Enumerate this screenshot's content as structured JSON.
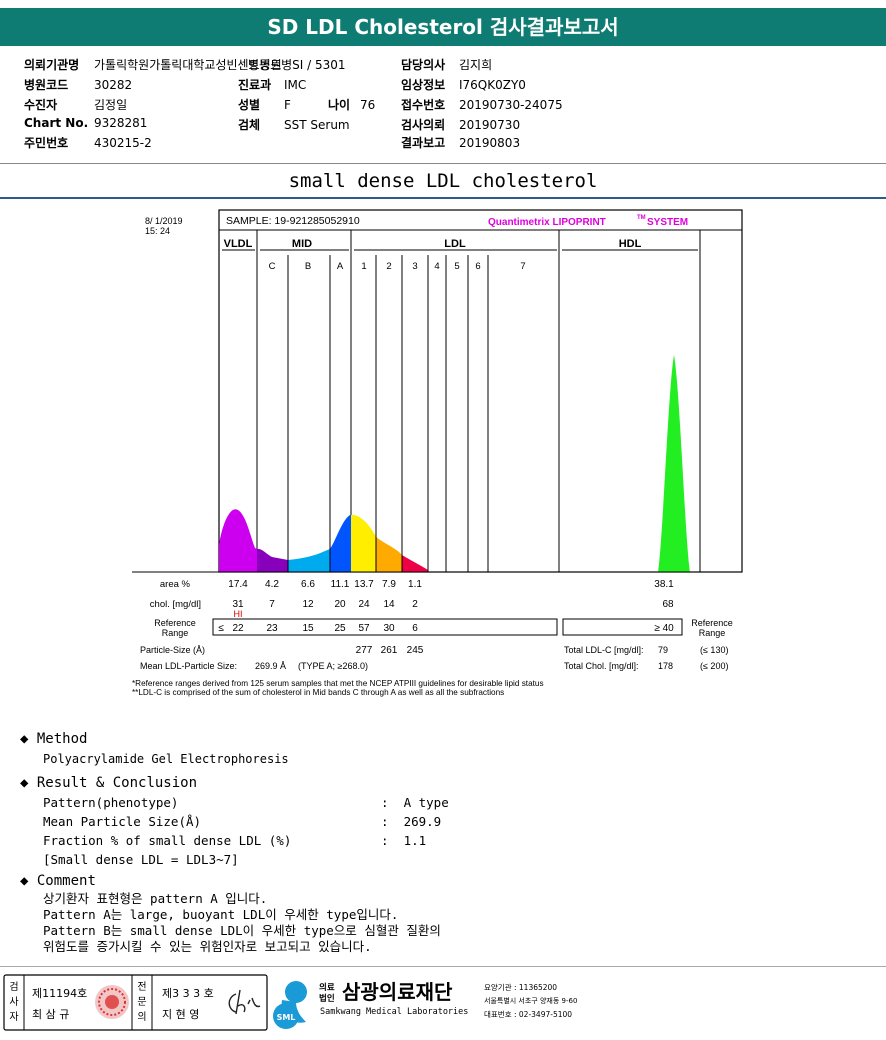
{
  "report_title": "SD LDL Cholesterol 검사결과보고서",
  "info": {
    "left": [
      {
        "label": "의뢰기관명",
        "value": "가톨릭학원가톨릭대학교성빈센트병원"
      },
      {
        "label": "병원코드",
        "value": "30282"
      },
      {
        "label": "수진자",
        "value": "김정일"
      },
      {
        "label": "Chart No.",
        "value": "9328281"
      },
      {
        "label": "주민번호",
        "value": "430215-2"
      }
    ],
    "mid": [
      {
        "label": "",
        "value": "병동트병SI / 5301"
      },
      {
        "label": "진료과",
        "value": "IMC"
      },
      {
        "label": "성별",
        "value": "F"
      },
      {
        "label": "검체",
        "value": "SST Serum"
      }
    ],
    "age": {
      "label": "나이",
      "value": "76"
    },
    "right": [
      {
        "label": "담당의사",
        "value": "김지희"
      },
      {
        "label": "임상정보",
        "value": "I76QK0ZY0"
      },
      {
        "label": "접수번호",
        "value": "20190730-24075"
      },
      {
        "label": "검사의뢰",
        "value": "20190730"
      },
      {
        "label": "결과보고",
        "value": "20190803"
      }
    ]
  },
  "subtitle": "small dense LDL cholesterol",
  "chart": {
    "date": "8/ 1/2019",
    "time": "15: 24",
    "sample": "SAMPLE:  19-921285052910",
    "system": "Quantimetrix LIPOPRINT",
    "system_tm": "TM",
    "system_suffix": "SYSTEM",
    "groups": [
      "VLDL",
      "MID",
      "LDL",
      "HDL"
    ],
    "bands": [
      "C",
      "B",
      "A",
      "1",
      "2",
      "3",
      "4",
      "5",
      "6",
      "7"
    ],
    "area_label": "area %",
    "chol_label": "chol. [mg/dl]",
    "ref_label": "Reference Range",
    "ref_label_right": "Reference Range",
    "area_values": [
      "17.4",
      "4.2",
      "6.6",
      "11.1",
      "13.7",
      "7.9",
      "1.1"
    ],
    "area_hdl": "38.1",
    "chol_values": [
      "31",
      "7",
      "12",
      "20",
      "24",
      "14",
      "2"
    ],
    "chol_hdl": "68",
    "hi_flag": "HI",
    "ref_prefix": "≤",
    "ref_values": [
      "22",
      "23",
      "15",
      "25",
      "57",
      "30",
      "6"
    ],
    "ref_hdl": "≥ 40",
    "particle_label": "Particle-Size (Å)",
    "particle_values": [
      "277",
      "261",
      "245"
    ],
    "mean_label": "Mean LDL-Particle Size:",
    "mean_value": "269.9 Å",
    "mean_type": "(TYPE A; ≥268.0)",
    "total_ldl_label": "Total LDL-C [mg/dl]:",
    "total_ldl_value": "79",
    "total_ldl_ref": "(≤ 130)",
    "total_chol_label": "Total Chol. [mg/dl]:",
    "total_chol_value": "178",
    "total_chol_ref": "(≤ 200)",
    "footnote1": "*Reference ranges derived from 125 serum samples that met the NCEP ATPIII guidelines for desirable lipid status",
    "footnote2": "**LDL-C is comprised of the sum of cholesterol in Mid bands C through A as well as all the subfractions"
  },
  "chart_data": {
    "type": "area",
    "title": "",
    "series": [
      {
        "name": "VLDL",
        "color": "#cc00ee"
      },
      {
        "name": "MID C",
        "color": "#8800cc"
      },
      {
        "name": "MID B",
        "color": "#00aaee"
      },
      {
        "name": "MID A",
        "color": "#0055ff"
      },
      {
        "name": "LDL 1",
        "color": "#ffee00"
      },
      {
        "name": "LDL 2",
        "color": "#ffaa00"
      },
      {
        "name": "LDL 3",
        "color": "#ee0044"
      },
      {
        "name": "HDL",
        "color": "#22ee22"
      }
    ],
    "area_percent": {
      "VLDL": 17.4,
      "C": 4.2,
      "B": 6.6,
      "A": 11.1,
      "1": 13.7,
      "2": 7.9,
      "3": 1.1,
      "HDL": 38.1
    },
    "chol_mg_dl": {
      "VLDL": 31,
      "C": 7,
      "B": 12,
      "A": 20,
      "1": 24,
      "2": 14,
      "3": 2,
      "HDL": 68
    }
  },
  "method": {
    "heading": "Method",
    "body": "Polyacrylamide Gel Electrophoresis"
  },
  "result": {
    "heading": "Result & Conclusion",
    "rows": [
      {
        "k": "Pattern(phenotype)",
        "v": "A type"
      },
      {
        "k": "Mean Particle Size(Å)",
        "v": "269.9"
      },
      {
        "k": "Fraction % of small dense LDL (%)",
        "v": "1.1"
      }
    ],
    "note": "[Small dense LDL = LDL3~7]"
  },
  "comment": {
    "heading": "Comment",
    "lines": [
      "상기환자 표현형은 pattern A 입니다.",
      "Pattern A는 large, buoyant LDL이 우세한 type입니다.",
      "Pattern B는 small dense LDL이 우세한 type으로 심혈관 질환의",
      "위험도를 증가시킬 수 있는 위험인자로 보고되고 있습니다."
    ]
  },
  "footer": {
    "examiner_tag": "검사자",
    "examiner_no": "제11194호",
    "examiner_name": "최 삼 규",
    "specialist_tag": "전문의",
    "specialist_no": "제3 3 3 호",
    "specialist_name": "지 현 영",
    "logo_small": "SML",
    "org_prefix": "의료법인",
    "org_name": "삼광의료재단",
    "org_en": "Samkwang Medical Laboratories",
    "care_code": "요양기관 : 11365200",
    "address": "서울특별시 서초구 양재동 9-60",
    "phone": "대표번호 : 02-3497-5100"
  }
}
